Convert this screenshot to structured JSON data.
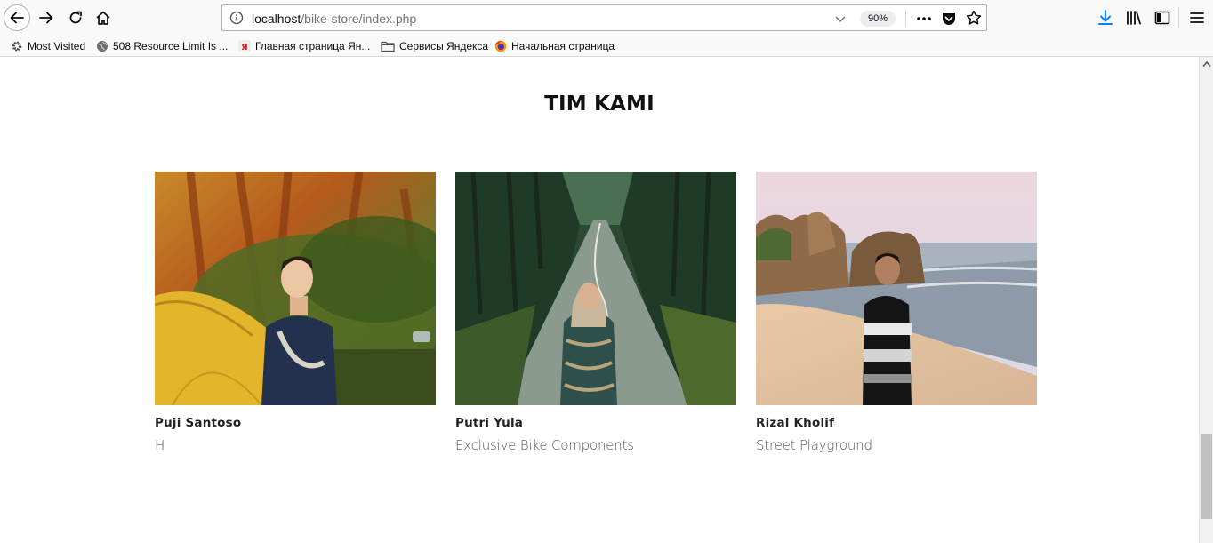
{
  "browser": {
    "url_host": "localhost",
    "url_path": "/bike-store/index.php",
    "zoom": "90%",
    "bookmarks": [
      {
        "label": "Most Visited",
        "icon": "gear-icon"
      },
      {
        "label": "508 Resource Limit Is ...",
        "icon": "globe-icon"
      },
      {
        "label": "Главная страница Ян...",
        "icon": "yandex-icon"
      },
      {
        "label": "Сервисы Яндекса",
        "icon": "folder-icon"
      },
      {
        "label": "Начальная страница",
        "icon": "firefox-icon"
      }
    ]
  },
  "team": {
    "title": "TIM KAMI",
    "members": [
      {
        "name": "Puji Santoso",
        "role": "H",
        "photo": "person-by-tent-in-forest"
      },
      {
        "name": "Putri Yula",
        "role": "Exclusive Bike Components",
        "photo": "person-on-forest-road"
      },
      {
        "name": "Rizal Kholif",
        "role": "Street Playground",
        "photo": "person-on-beach"
      }
    ]
  },
  "colors": {
    "chrome_bg": "#f9f9fa",
    "accent_download": "#0a84ff",
    "title_text": "#111111",
    "role_text": "#555555"
  }
}
